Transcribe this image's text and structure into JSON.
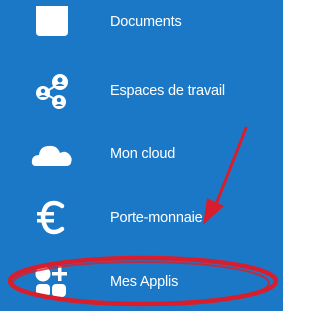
{
  "menu": {
    "items": [
      {
        "label": "Documents",
        "icon": "folder-icon"
      },
      {
        "label": "Espaces de travail",
        "icon": "workspaces-icon"
      },
      {
        "label": "Mon cloud",
        "icon": "cloud-icon"
      },
      {
        "label": "Porte-monnaie",
        "icon": "euro-icon"
      },
      {
        "label": "Mes Applis",
        "icon": "apps-icon"
      }
    ]
  },
  "colors": {
    "background": "#1b78c7",
    "text": "#ffffff",
    "annotation": "#d81e2c"
  }
}
